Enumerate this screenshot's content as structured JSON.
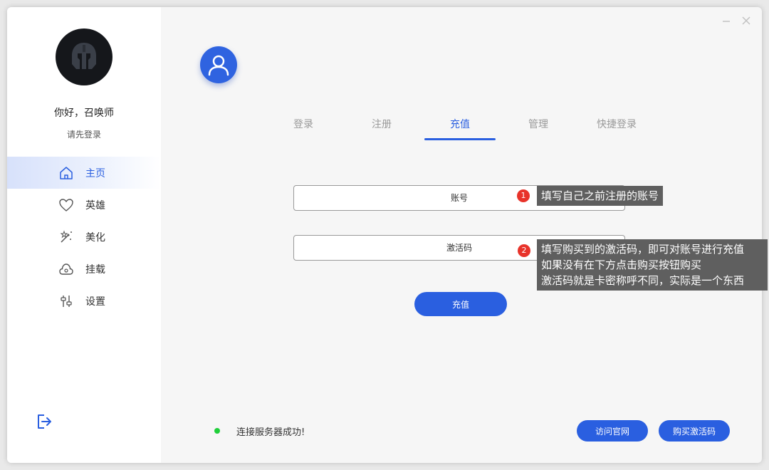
{
  "sidebar": {
    "greeting": "你好，召唤师",
    "login_hint": "请先登录",
    "items": [
      {
        "label": "主页",
        "icon": "home-icon"
      },
      {
        "label": "英雄",
        "icon": "heart-icon"
      },
      {
        "label": "美化",
        "icon": "magic-wand-icon"
      },
      {
        "label": "挂载",
        "icon": "cloud-icon"
      },
      {
        "label": "设置",
        "icon": "sliders-icon"
      }
    ],
    "active_index": 0
  },
  "main": {
    "tabs": [
      {
        "label": "登录"
      },
      {
        "label": "注册"
      },
      {
        "label": "充值"
      },
      {
        "label": "管理"
      },
      {
        "label": "快捷登录"
      }
    ],
    "active_tab": 2,
    "account": {
      "placeholder": "账号",
      "value": ""
    },
    "activation_code": {
      "placeholder": "激活码",
      "value": ""
    },
    "recharge_label": "充值",
    "status_text": "连接服务器成功!",
    "visit_site_label": "访问官网",
    "buy_code_label": "购买激活码"
  },
  "tooltips": [
    {
      "number": "1",
      "lines": [
        "填写自己之前注册的账号"
      ]
    },
    {
      "number": "2",
      "lines": [
        "填写购买到的激活码，即可对账号进行充值",
        "如果没有在下方点击购买按钮购买",
        "激活码就是卡密称呼不同，实际是一个东西"
      ]
    }
  ],
  "colors": {
    "accent": "#2a5fe0",
    "status_ok": "#1fcf3a",
    "badge": "#e8332a",
    "tooltip_bg": "#5f5f5f"
  }
}
